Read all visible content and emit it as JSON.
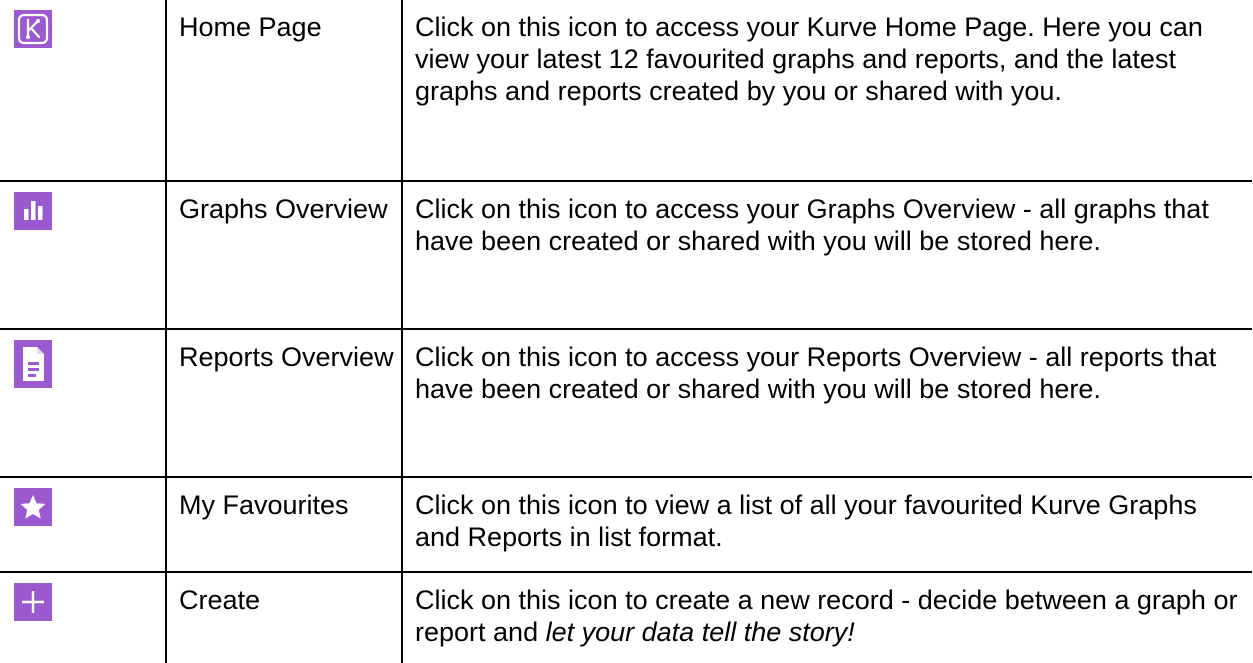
{
  "accent_color": "#9b59d0",
  "rows": [
    {
      "icon": "kurve-logo-icon",
      "name": "Home Page",
      "description": "Click on this icon to access your Kurve Home Page. Here you can view your latest 12 favourited graphs and reports, and the latest graphs and reports created by you or shared with you."
    },
    {
      "icon": "bar-chart-icon",
      "name": "Graphs Overview",
      "description": "Click on this icon to access your Graphs Overview - all graphs that have been created or shared with you will be stored here."
    },
    {
      "icon": "document-icon",
      "name": "Reports Overview",
      "description": "Click on this icon to access your Reports Overview - all reports that have been created or shared with you will be stored here."
    },
    {
      "icon": "star-icon",
      "name": "My Favourites",
      "description": "Click on this icon to view a list of all your favourited Kurve Graphs and Reports in list format."
    },
    {
      "icon": "plus-icon",
      "name": "Create",
      "description": "Click on this icon to create a new record - decide between a graph or report and",
      "description_emphasis": "let your data tell the story!"
    }
  ]
}
